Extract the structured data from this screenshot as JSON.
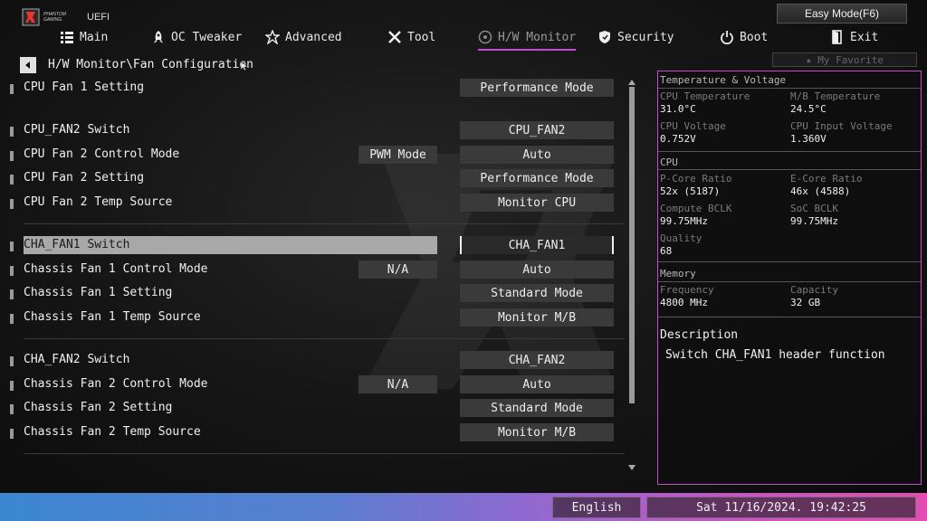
{
  "header": {
    "brand_line1": "PHANTOM",
    "brand_line2": "GAMING",
    "brand_uefi": "UEFI",
    "easy_mode_label": "Easy Mode(F6)"
  },
  "tabs": [
    {
      "label": "Main",
      "icon": "list-icon"
    },
    {
      "label": "OC Tweaker",
      "icon": "rocket-icon"
    },
    {
      "label": "Advanced",
      "icon": "star-icon"
    },
    {
      "label": "Tool",
      "icon": "wrench-icon"
    },
    {
      "label": "H/W Monitor",
      "icon": "monitor-icon",
      "active": true
    },
    {
      "label": "Security",
      "icon": "shield-icon"
    },
    {
      "label": "Boot",
      "icon": "power-icon"
    },
    {
      "label": "Exit",
      "icon": "exit-icon"
    }
  ],
  "breadcrumb": "H/W Monitor\\Fan Configuration",
  "favorite_label": "★ My Favorite",
  "settings": [
    {
      "label": "CPU Fan 1 Setting",
      "value": "Performance Mode"
    },
    {
      "label": "CPU_FAN2 Switch",
      "value": "CPU_FAN2"
    },
    {
      "label": "CPU Fan 2 Control Mode",
      "mid": "PWM Mode",
      "value": "Auto"
    },
    {
      "label": "CPU Fan 2 Setting",
      "value": "Performance Mode"
    },
    {
      "label": "CPU Fan 2 Temp Source",
      "value": "Monitor CPU"
    },
    {
      "label": "CHA_FAN1 Switch",
      "value": "CHA_FAN1",
      "selected": true
    },
    {
      "label": "Chassis Fan 1 Control Mode",
      "mid": "N/A",
      "value": "Auto"
    },
    {
      "label": "Chassis Fan 1 Setting",
      "value": "Standard Mode"
    },
    {
      "label": "Chassis Fan 1 Temp Source",
      "value": "Monitor M/B"
    },
    {
      "label": "CHA_FAN2 Switch",
      "value": "CHA_FAN2"
    },
    {
      "label": "Chassis Fan 2 Control Mode",
      "mid": "N/A",
      "value": "Auto"
    },
    {
      "label": "Chassis Fan 2 Setting",
      "value": "Standard Mode"
    },
    {
      "label": "Chassis Fan 2 Temp Source",
      "value": "Monitor M/B"
    }
  ],
  "panel": {
    "temp_voltage": {
      "title": "Temperature & Voltage",
      "items": [
        {
          "label": "CPU Temperature",
          "value": "31.0°C"
        },
        {
          "label": "M/B Temperature",
          "value": "24.5°C"
        },
        {
          "label": "CPU Voltage",
          "value": "0.752V"
        },
        {
          "label": "CPU Input Voltage",
          "value": "1.360V"
        }
      ]
    },
    "cpu": {
      "title": "CPU",
      "items": [
        {
          "label": "P-Core Ratio",
          "value": "52x (5187)"
        },
        {
          "label": "E-Core Ratio",
          "value": "46x (4588)"
        },
        {
          "label": "Compute BCLK",
          "value": "99.75MHz"
        },
        {
          "label": "SoC BCLK",
          "value": "99.75MHz"
        },
        {
          "label": "Quality",
          "value": "68"
        }
      ]
    },
    "memory": {
      "title": "Memory",
      "items": [
        {
          "label": "Frequency",
          "value": "4800 MHz"
        },
        {
          "label": "Capacity",
          "value": "32 GB"
        }
      ]
    },
    "description": {
      "title": "Description",
      "text": "Switch CHA_FAN1 header function"
    }
  },
  "footer": {
    "language": "English",
    "datetime": "Sat 11/16/2024. 19:42:25"
  },
  "colors": {
    "accent": "#c04fcf",
    "footer_left": "#3b86d0",
    "footer_right": "#e04fb0"
  }
}
